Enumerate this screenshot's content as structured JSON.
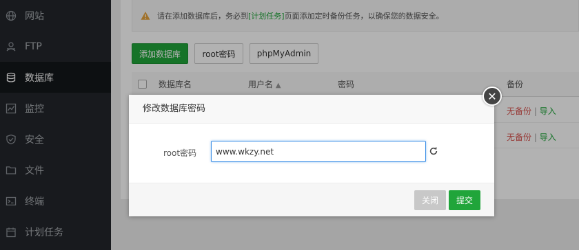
{
  "sidebar": {
    "items": [
      {
        "label": "网站",
        "icon": "globe-icon"
      },
      {
        "label": "FTP",
        "icon": "ftp-icon"
      },
      {
        "label": "数据库",
        "icon": "database-icon",
        "active": true
      },
      {
        "label": "监控",
        "icon": "monitor-icon"
      },
      {
        "label": "安全",
        "icon": "shield-icon"
      },
      {
        "label": "文件",
        "icon": "folder-icon"
      },
      {
        "label": "终端",
        "icon": "terminal-icon"
      },
      {
        "label": "计划任务",
        "icon": "calendar-icon"
      }
    ]
  },
  "alert": {
    "text_before": "请在添加数据库后，务必到",
    "link": "[计划任务]",
    "text_after": "页面添加定时备份任务，以确保您的数据安全。"
  },
  "toolbar": {
    "add_db": "添加数据库",
    "root_pw": "root密码",
    "phpmyadmin": "phpMyAdmin"
  },
  "table": {
    "headers": {
      "db_name": "数据库名",
      "username": "用户名",
      "password": "密码",
      "backup": "备份"
    },
    "rows": [
      {
        "backup_status": "无备份",
        "separator": "|",
        "import": "导入"
      },
      {
        "backup_status": "无备份",
        "separator": "|",
        "import": "导入"
      }
    ]
  },
  "modal": {
    "title": "修改数据库密码",
    "field_label": "root密码",
    "field_value": "www.wkzy.net",
    "close_btn": "关闭",
    "submit_btn": "提交"
  },
  "colors": {
    "accent": "#20a53a",
    "sidebar_bg": "#23262b",
    "danger": "#d9534f"
  }
}
